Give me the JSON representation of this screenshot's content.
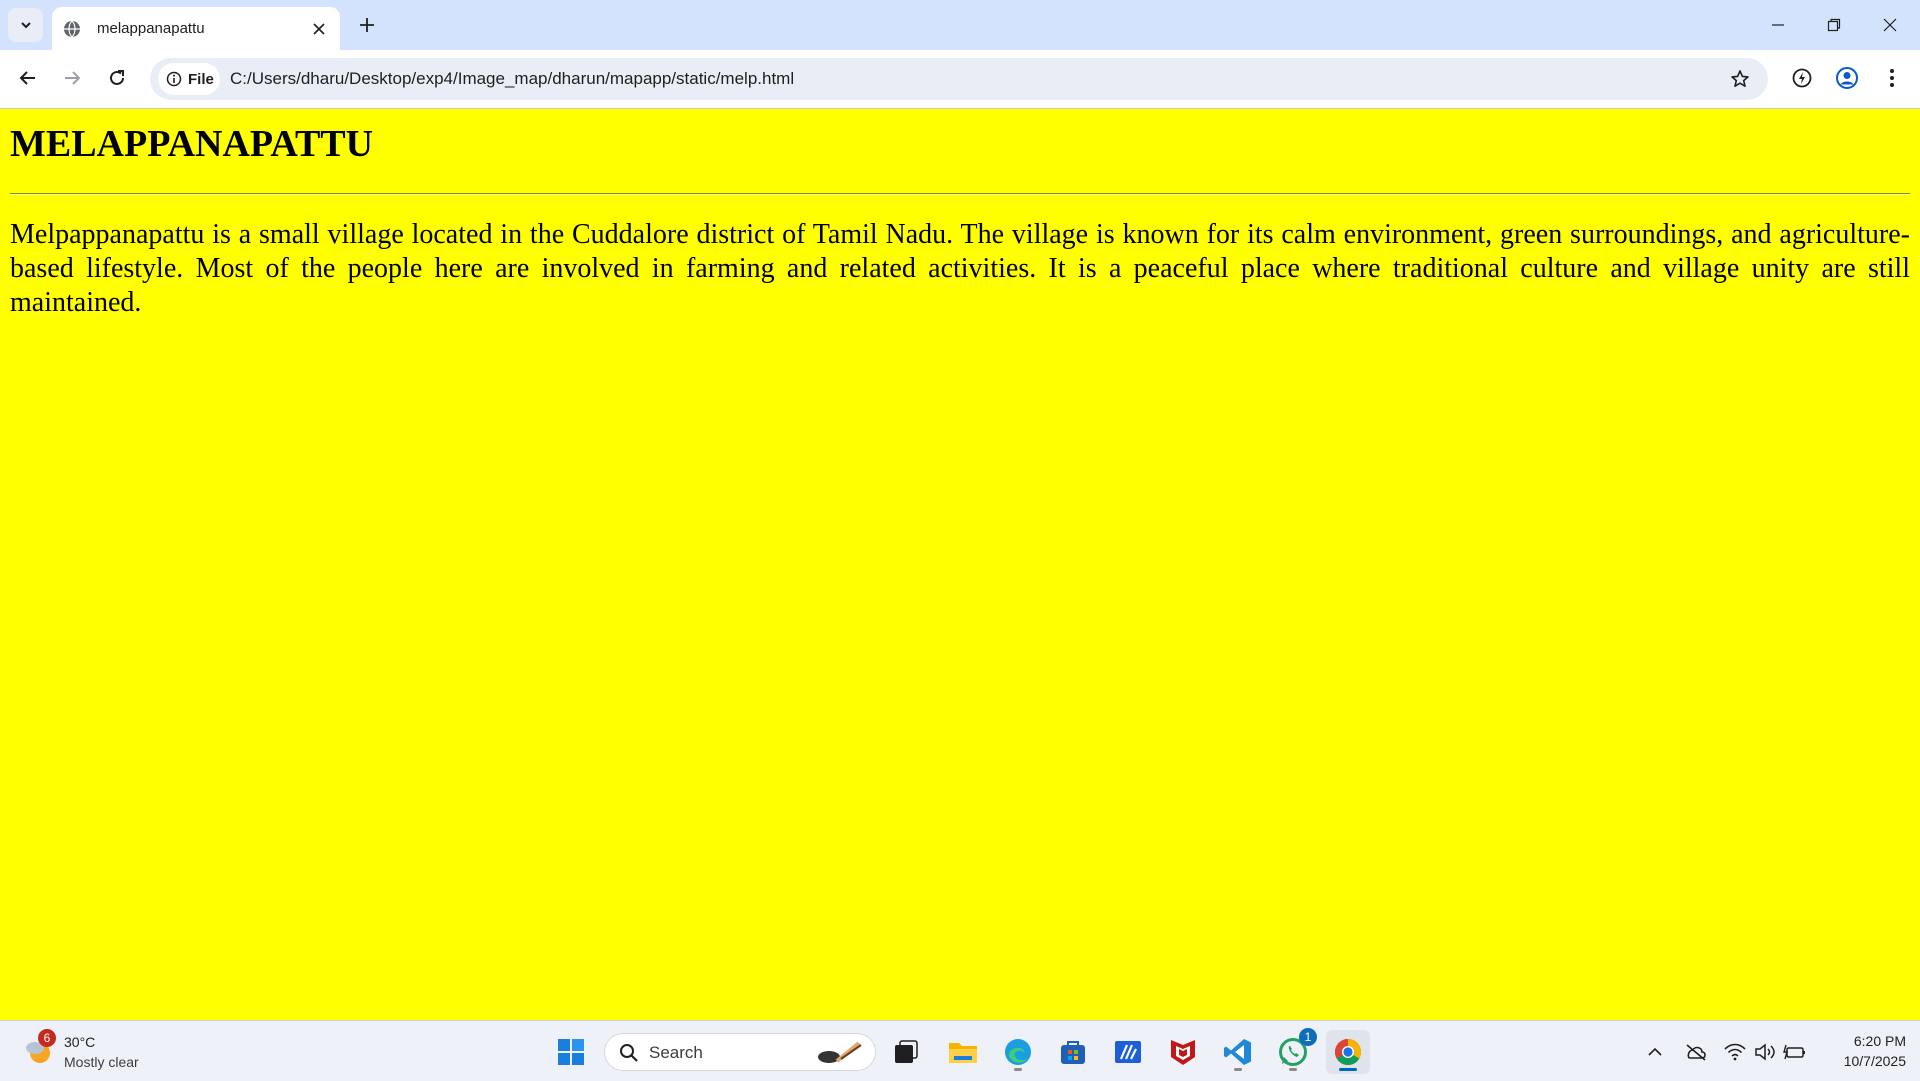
{
  "browser": {
    "tab": {
      "title": "melappanapattu"
    },
    "address_bar": {
      "chip_label": "File",
      "url": "C:/Users/dharu/Desktop/exp4/Image_map/dharun/mapapp/static/melp.html"
    }
  },
  "page": {
    "heading": "MELAPPANAPATTU",
    "paragraph": "Melpappanapattu is a small village located in the Cuddalore district of Tamil Nadu. The village is known for its calm environment, green surroundings, and agriculture-based lifestyle. Most of the people here are involved in farming and related activities. It is a peaceful place where traditional culture and village unity are still maintained.",
    "background_color": "#ffff00"
  },
  "taskbar": {
    "weather": {
      "badge": "6",
      "temperature": "30°C",
      "condition": "Mostly clear"
    },
    "search_label": "Search",
    "pinned_apps": [
      {
        "name": "task-view"
      },
      {
        "name": "file-explorer"
      },
      {
        "name": "edge"
      },
      {
        "name": "microsoft-store"
      },
      {
        "name": "app-blue-a"
      },
      {
        "name": "mcafee"
      },
      {
        "name": "vscode"
      },
      {
        "name": "whatsapp",
        "badge": "1"
      },
      {
        "name": "chrome"
      }
    ],
    "clock": {
      "time": "6:20 PM",
      "date": "10/7/2025"
    }
  }
}
